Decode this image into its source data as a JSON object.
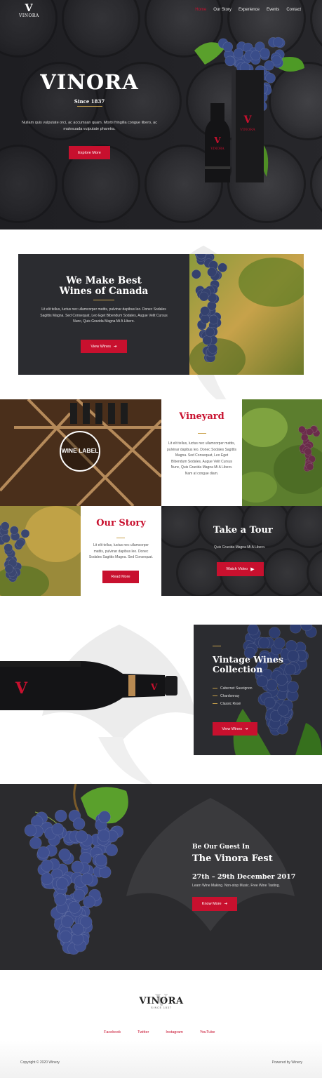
{
  "brand": {
    "logo_letter": "V",
    "logo_text": "VINORA"
  },
  "nav": {
    "items": [
      "Home",
      "Our Story",
      "Experience",
      "Events",
      "Contact"
    ]
  },
  "hero": {
    "title": "VINORA",
    "since": "Since 1837",
    "description": "Nullam quis vulputate orci, ac accumsan quam. Morbi fringilla congue libero, ac malesuada vulputate pharetra.",
    "button": "Explore More",
    "box_label": "VINORA",
    "bottle_label": "VINORA"
  },
  "best": {
    "title_line1": "We Make Best",
    "title_line2": "Wines of Canada",
    "text": "Lit elit tellus, luctus nec ullamcorper mattis, pulvinar dapibus leo. Donec Sodales Sagittis Magna. Sed Consequat, Leo Eget Bibendum Sodales, Augue Velit Cursus Nunc, Quis Gravida Magna Mi A Libero.",
    "button": "View Wines"
  },
  "vineyard": {
    "wine_label_title": "WINE LABEL",
    "title": "Vineyard",
    "text": "Lit elit tellus, luctus nec ullamcorper mattis, pulvinar dapibus leo. Donec Sodales Sagittis Magna. Sed Consequat, Leo Eget Bibendum Sodales, Augue Velit Cursus Nunc, Quis Gravida Magna Mi A Libero. Nam at congue diam."
  },
  "story": {
    "title": "Our Story",
    "text": "Lit elit tellus, luctus nec ullamcorper mattis, pulvinar dapibus leo. Donec Sodales Sagittis Magna. Sed Consequat.",
    "button": "Read More"
  },
  "tour": {
    "title": "Take a Tour",
    "text": "Quis Gravida Magna Mi A Libero.",
    "button": "Watch Video"
  },
  "collection": {
    "title_line1": "Vintage Wines",
    "title_line2": "Collection",
    "items": [
      "Cabernet Sauvignon",
      "Chardonnay",
      "Classic Rosé"
    ],
    "button": "View Wines",
    "bottle_label": "VINORA"
  },
  "fest": {
    "pre": "Be Our Guest In",
    "title": "The Vinora Fest",
    "date": "27th – 29th December 2017",
    "text": "Learn Wine Making. Non-stop Music. Free Wine Tasting.",
    "button": "Know More"
  },
  "footer": {
    "logo_text": "VINORA",
    "since": "SINCE 1837",
    "links": [
      "Facebook",
      "Twitter",
      "Instagram",
      "YouTube"
    ],
    "copyright": "Copyright © 2020 Winery",
    "powered": "Powered by Winery"
  },
  "colors": {
    "accent": "#c8102e",
    "dark": "#2b2c30",
    "gold": "#c9a24b"
  }
}
